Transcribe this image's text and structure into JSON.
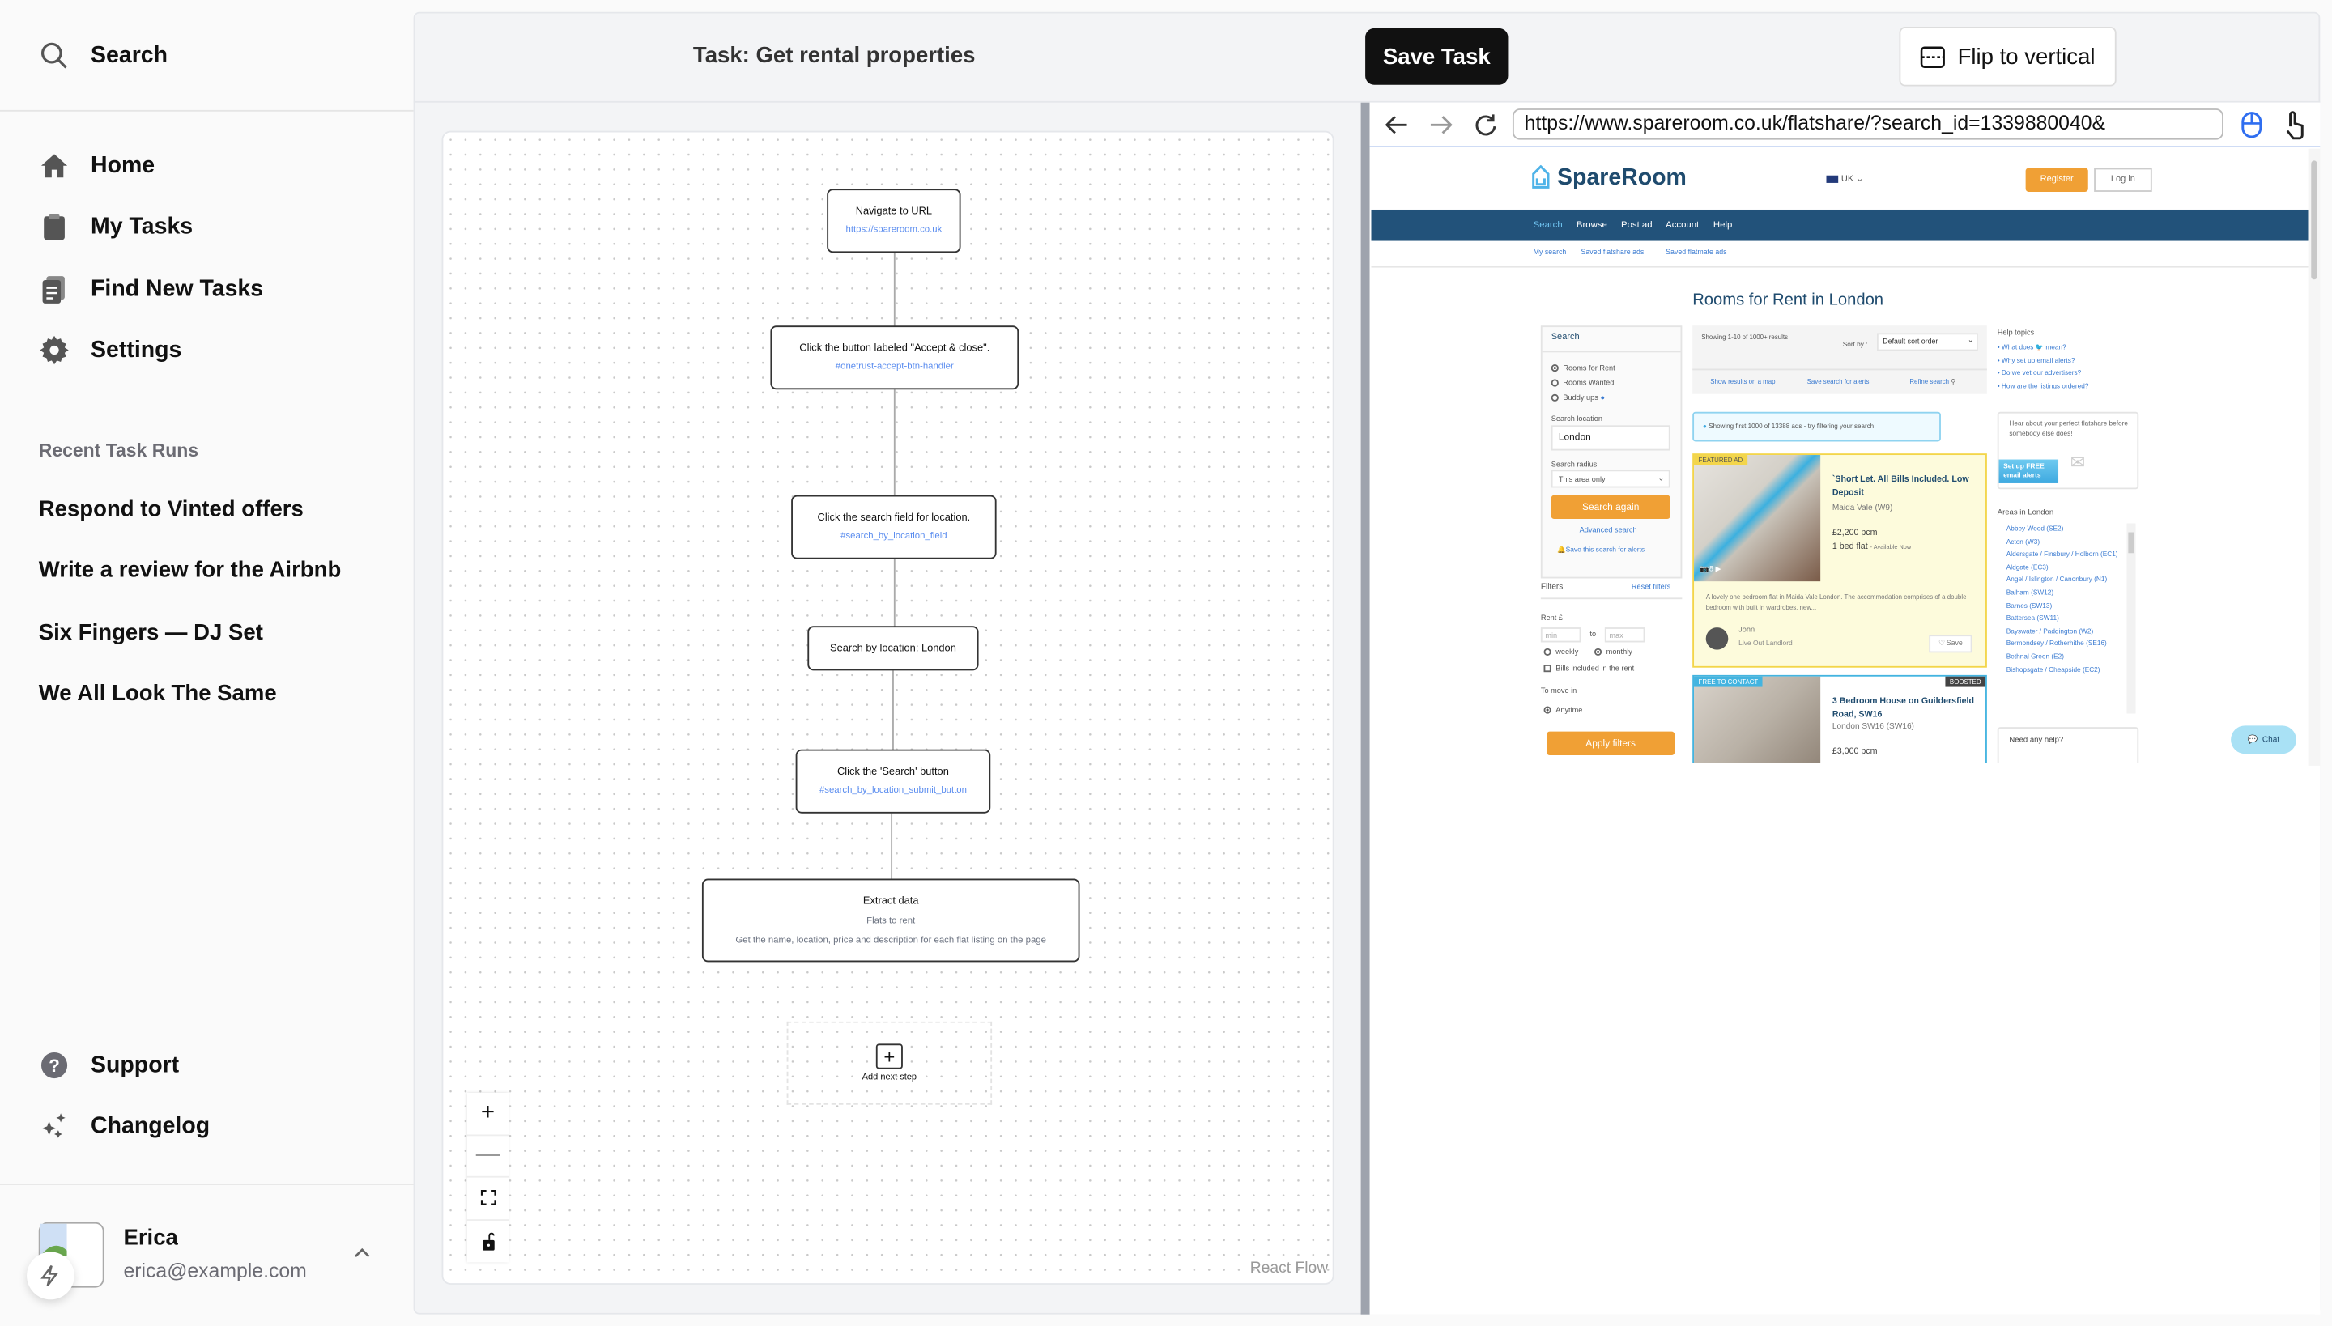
{
  "sidebar": {
    "search_label": "Search",
    "nav": [
      {
        "label": "Home",
        "icon": "home-icon"
      },
      {
        "label": "My Tasks",
        "icon": "clipboard-icon"
      },
      {
        "label": "Find New Tasks",
        "icon": "document-search-icon"
      },
      {
        "label": "Settings",
        "icon": "gear-icon"
      }
    ],
    "recent_heading": "Recent Task Runs",
    "recent": [
      "Respond to Vinted offers",
      "Write a review for the Airbnb",
      "Six Fingers — DJ Set",
      "We All Look The Same"
    ],
    "support_label": "Support",
    "changelog_label": "Changelog",
    "user": {
      "name": "Erica",
      "email": "erica@example.com"
    }
  },
  "header": {
    "task_title": "Task: Get rental properties",
    "save_label": "Save Task",
    "flip_label": "Flip to vertical"
  },
  "flow": {
    "nodes": [
      {
        "title": "Navigate to URL",
        "detail": "https://spareroom.co.uk"
      },
      {
        "title": "Click the button labeled \"Accept & close\".",
        "detail": "#onetrust-accept-btn-handler"
      },
      {
        "title": "Click the search field for location.",
        "detail": "#search_by_location_field"
      },
      {
        "title": "Search by location: London"
      },
      {
        "title": "Click the 'Search' button",
        "detail": "#search_by_location_submit_button"
      },
      {
        "title": "Extract data",
        "subtitle": "Flats to rent",
        "detail": "Get the name, location, price and description for each flat listing on the page"
      }
    ],
    "add_step_label": "Add next step",
    "controls": [
      "zoom-in",
      "zoom-out",
      "fit-view",
      "lock"
    ],
    "attribution": "React Flow"
  },
  "browser": {
    "url": "https://www.spareroom.co.uk/flatshare/?search_id=1339880040&",
    "page": {
      "logo": "SpareRoom",
      "locale": "UK",
      "register": "Register",
      "login": "Log in",
      "nav": [
        "Search",
        "Browse",
        "Post ad",
        "Account",
        "Help"
      ],
      "subnav": [
        "My search",
        "Saved flatshare ads",
        "Saved flatmate ads"
      ],
      "title": "Rooms for Rent in London",
      "search_panel": {
        "heading": "Search",
        "types": [
          "Rooms for Rent",
          "Rooms Wanted",
          "Buddy ups"
        ],
        "location_label": "Search location",
        "location_value": "London",
        "radius_label": "Search radius",
        "radius_value": "This area only",
        "search_again": "Search again",
        "advanced": "Advanced search",
        "save_alerts": "Save this search for alerts",
        "filters": "Filters",
        "reset": "Reset filters",
        "rent_label": "Rent £",
        "min_placeholder": "min",
        "to": "to",
        "max_placeholder": "max",
        "weekly": "weekly",
        "monthly": "monthly",
        "bills": "Bills included in the rent",
        "move_in": "To move in",
        "anytime": "Anytime",
        "apply": "Apply filters"
      },
      "results": {
        "showing": "Showing 1-10 of 1000+ results",
        "sort_label": "Sort by :",
        "sort_value": "Default sort order",
        "map": "Show results on a map",
        "save_search": "Save search for alerts",
        "refine": "Refine search",
        "info": "Showing first 1000 of 13388 ads - try filtering your search",
        "listings": [
          {
            "badge": "FEATURED AD",
            "title": "`Short Let. All Bills Included. Low Deposit",
            "location": "Maida Vale (W9)",
            "price": "£2,200 pcm",
            "type": "1 bed flat",
            "availability": "- Available Now",
            "photos": "8",
            "description": "A lovely one bedroom flat in Maida Vale London. The accommodation comprises of a double bedroom with built in wardrobes, new...",
            "advertiser": "John",
            "advertiser_type": "Live Out Landlord",
            "save": "Save"
          },
          {
            "badge": "FREE TO CONTACT",
            "badge2": "BOOSTED",
            "title": "3 Bedroom House on Guildersfield Road, SW16",
            "location": "London SW16 (SW16)",
            "price": "£3,000 pcm"
          }
        ]
      },
      "help": {
        "heading": "Help topics",
        "topics": [
          "What does",
          "mean?",
          "Why set up email alerts?",
          "Do we vet our advertisers?",
          "How are the listings ordered?"
        ],
        "alert_text": "Hear about your perfect flatshare before somebody else does!",
        "alert_cta": "Set up FREE email alerts",
        "areas_heading": "Areas in London",
        "areas": [
          "Abbey Wood (SE2)",
          "Acton (W3)",
          "Aldersgate / Finsbury / Holborn (EC1)",
          "Aldgate (EC3)",
          "Angel / Islington / Canonbury (N1)",
          "Balham (SW12)",
          "Barnes (SW13)",
          "Battersea (SW11)",
          "Bayswater / Paddington (W2)",
          "Bermondsey / Rotherhithe (SE16)",
          "Bethnal Green (E2)",
          "Bishopsgate / Cheapside (EC2)"
        ],
        "need_help": "Need any help?",
        "chat": "Chat"
      }
    }
  },
  "colors": {
    "accent": "#111111",
    "link": "#5b8def",
    "spareroom_nav": "#22527a",
    "spareroom_orange": "#f0a035"
  }
}
